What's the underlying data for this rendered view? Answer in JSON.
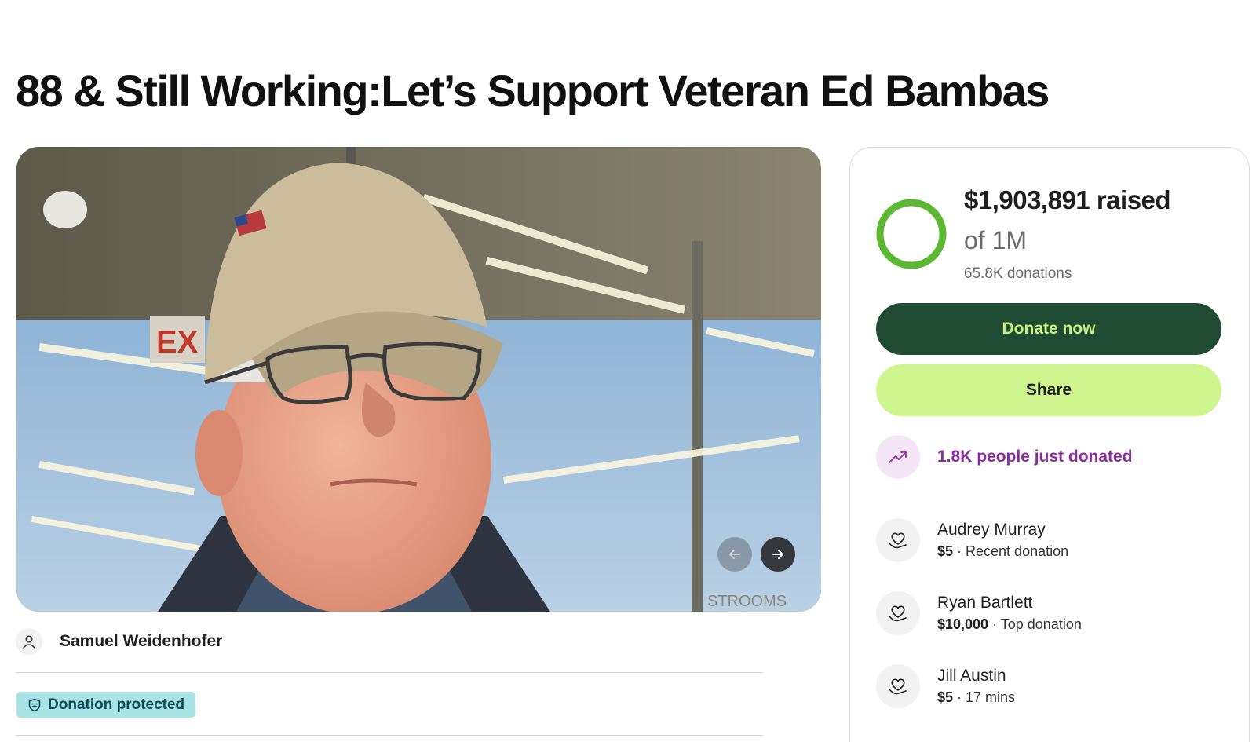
{
  "page": {
    "title": "88 & Still Working:Let’s Support Veteran Ed Bambas"
  },
  "organizer": {
    "name": "Samuel Weidenhofer",
    "icon": "person-icon"
  },
  "badge": {
    "label": "Donation protected",
    "icon": "shield-icon"
  },
  "carousel": {
    "prev_icon": "arrow-left-icon",
    "next_icon": "arrow-right-icon"
  },
  "stats": {
    "raised": "$1,903,891 raised",
    "goal": "of 1M",
    "donations": "65.8K donations",
    "progress_fraction": 1.0
  },
  "buttons": {
    "donate": "Donate now",
    "share": "Share"
  },
  "trend": {
    "label": "1.8K people just donated",
    "icon": "trending-up-icon"
  },
  "donors": [
    {
      "name": "Audrey Murray",
      "amount": "$5",
      "note": " · Recent donation",
      "icon": "heart-hand-icon"
    },
    {
      "name": "Ryan Bartlett",
      "amount": "$10,000",
      "note": " · Top donation",
      "icon": "heart-hand-icon"
    },
    {
      "name": "Jill Austin",
      "amount": "$5",
      "note": " · 17 mins",
      "icon": "heart-hand-icon"
    }
  ],
  "colors": {
    "donate_bg": "#1e4b32",
    "share_bg": "#cff58e",
    "ring": "#8fd14f",
    "trend_text": "#8a2d9c",
    "badge_bg": "#a9e3e6"
  }
}
